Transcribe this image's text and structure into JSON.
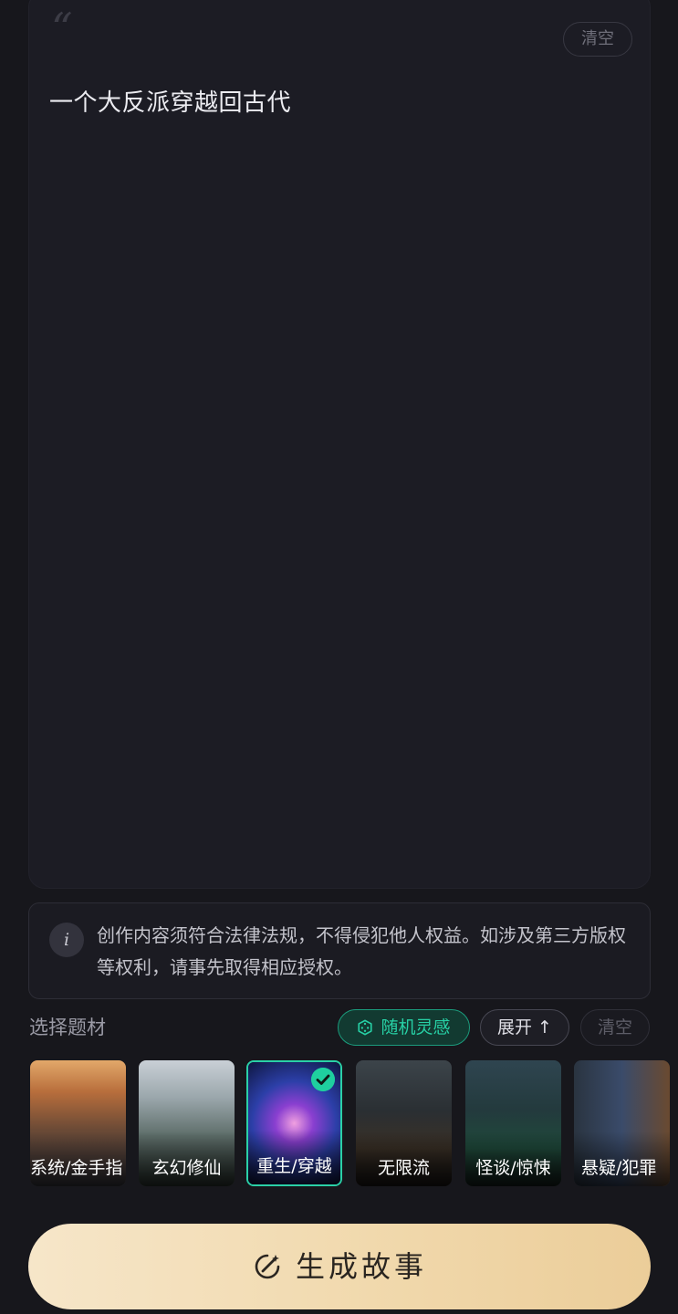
{
  "prompt": {
    "quote_mark": "“",
    "clear_label": "清空",
    "text": "一个大反派穿越回古代"
  },
  "notice": {
    "icon": "info-icon",
    "text": "创作内容须符合法律法规，不得侵犯他人权益。如涉及第三方版权等权利，请事先取得相应授权。"
  },
  "topics": {
    "section_label": "选择题材",
    "random_label": "随机灵感",
    "expand_label": "展开 ↑",
    "clear_label": "清空",
    "items": [
      {
        "label": "系统/金手指",
        "selected": false
      },
      {
        "label": "玄幻修仙",
        "selected": false
      },
      {
        "label": "重生/穿越",
        "selected": true
      },
      {
        "label": "无限流",
        "selected": false
      },
      {
        "label": "怪谈/惊悚",
        "selected": false
      },
      {
        "label": "悬疑/犯罪",
        "selected": false
      }
    ]
  },
  "generate": {
    "label": "生成故事",
    "icon": "magic-wand-icon"
  },
  "colors": {
    "background": "#17171c",
    "accent_green": "#27d0a5",
    "button_gold": "#f1d9ad"
  }
}
